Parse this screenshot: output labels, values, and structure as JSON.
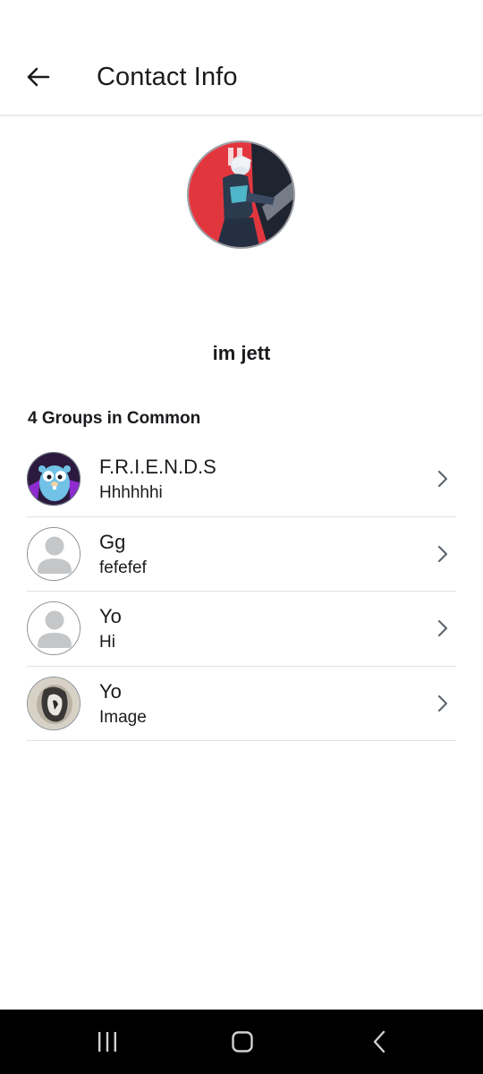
{
  "header": {
    "title": "Contact Info",
    "back_icon": "arrow-back-icon"
  },
  "profile": {
    "name": "im jett",
    "avatar": "profile-photo"
  },
  "groups": {
    "heading": "4 Groups in Common",
    "items": [
      {
        "name": "F.R.I.E.N.D.S",
        "message": "Hhhhhhi",
        "avatar": "gopher-image"
      },
      {
        "name": "Gg",
        "message": "fefefef",
        "avatar": "default-user-icon"
      },
      {
        "name": "Yo",
        "message": "Hi",
        "avatar": "default-user-icon"
      },
      {
        "name": "Yo",
        "message": "Image",
        "avatar": "photo-image"
      }
    ]
  },
  "colors": {
    "accent_red": "#e2363f",
    "text": "#1b1b1f",
    "divider": "#e2e2e2",
    "placeholder_gray": "#c4c6c8"
  },
  "nav": {
    "recents_icon": "recents-icon",
    "home_icon": "home-icon",
    "back_icon": "nav-back-icon"
  }
}
